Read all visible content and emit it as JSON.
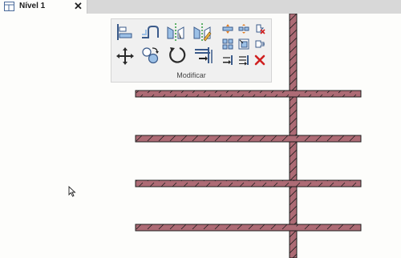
{
  "tab": {
    "label": "Nível 1",
    "close_glyph": "✕",
    "icon": "floor-plan-view-icon"
  },
  "panel": {
    "title": "Modificar",
    "tools": [
      "align-icon",
      "offset-icon",
      "mirror-pick-axis-icon",
      "mirror-draw-axis-icon",
      "split-element-icon",
      "split-with-gap-icon",
      "unpin-icon",
      "move-icon",
      "copy-icon",
      "rotate-icon",
      "trim-extend-corner-icon",
      "array-icon",
      "scale-icon",
      "pin-icon",
      "trim-extend-single-icon",
      "trim-extend-multiple-icon",
      "delete-icon"
    ]
  },
  "colors": {
    "wall_fill": "#ad6b75",
    "wall_stroke": "#1e1e1e",
    "tab_bar": "#d8d8d8",
    "background": "#fdfdfb"
  }
}
